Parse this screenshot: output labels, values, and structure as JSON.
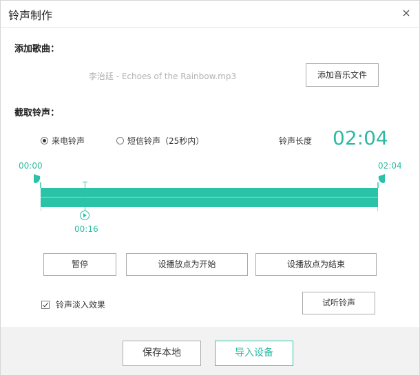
{
  "window": {
    "title": "铃声制作"
  },
  "add_song": {
    "label": "添加歌曲：",
    "file_name": "李治廷 - Echoes of the Rainbow.mp3",
    "add_button": "添加音乐文件"
  },
  "clip": {
    "label": "截取铃声：",
    "radio_call": "来电铃声",
    "radio_sms": "短信铃声（25秒内）",
    "selected": "来电铃声",
    "length_label": "铃声长度",
    "length_value": "02:04",
    "start_time": "00:00",
    "end_time": "02:04",
    "play_time": "00:16",
    "progress_fraction": 0.129
  },
  "controls": {
    "pause": "暂停",
    "set_start": "设播放点为开始",
    "set_end": "设播放点为结束",
    "fade_checkbox": "铃声淡入效果",
    "fade_checked": true,
    "preview": "试听铃声"
  },
  "footer": {
    "save_local": "保存本地",
    "import_device": "导入设备"
  },
  "colors": {
    "accent": "#2bc3a7",
    "text": "#333333"
  },
  "icons": {
    "close": "close-icon",
    "play": "play-icon"
  }
}
